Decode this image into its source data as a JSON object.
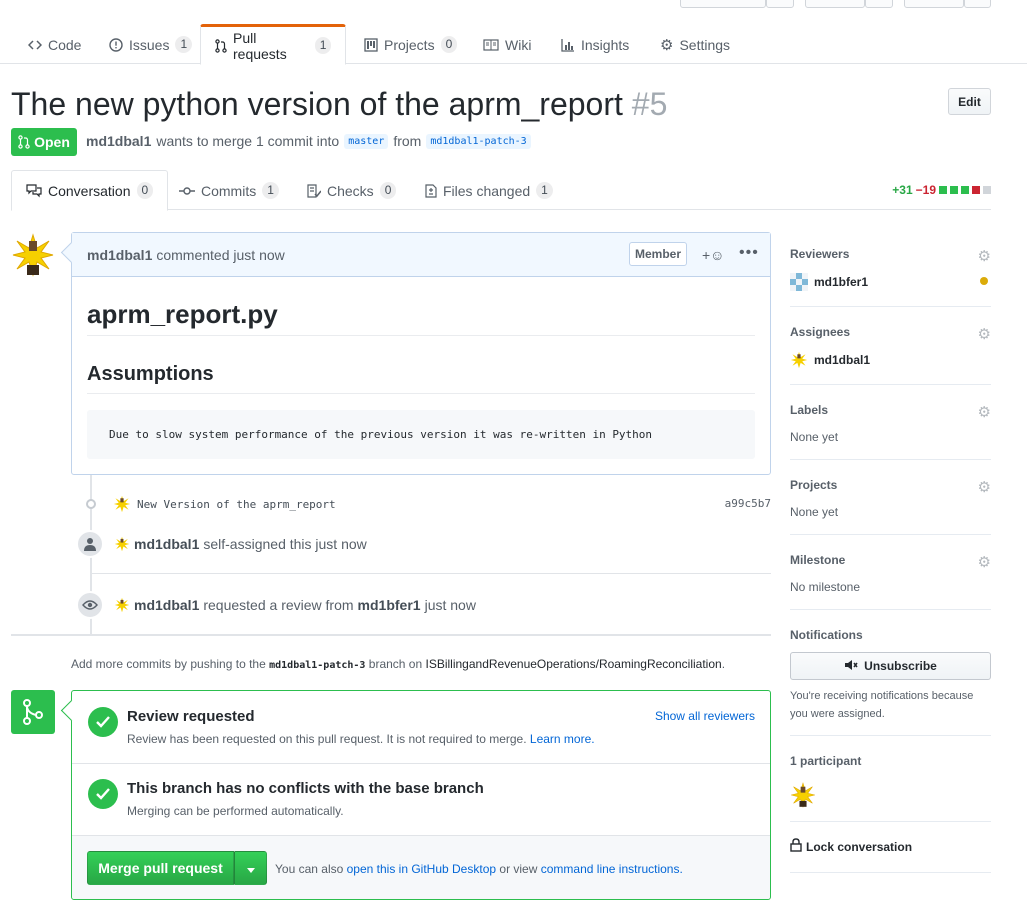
{
  "repo_tabs": [
    {
      "label": "Code",
      "count": null
    },
    {
      "label": "Issues",
      "count": "1"
    },
    {
      "label": "Pull requests",
      "count": "1"
    },
    {
      "label": "Projects",
      "count": "0"
    },
    {
      "label": "Wiki",
      "count": null
    },
    {
      "label": "Insights",
      "count": null
    },
    {
      "label": "Settings",
      "count": null
    }
  ],
  "pr": {
    "title": "The new python version of the aprm_report",
    "number": "#5",
    "edit_label": "Edit",
    "state": "Open",
    "author": "md1dbal1",
    "merge_text": "wants to merge 1 commit into",
    "base_branch": "master",
    "from_text": "from",
    "head_branch": "md1dbal1-patch-3"
  },
  "pr_tabs": [
    {
      "label": "Conversation",
      "count": "0"
    },
    {
      "label": "Commits",
      "count": "1"
    },
    {
      "label": "Checks",
      "count": "0"
    },
    {
      "label": "Files changed",
      "count": "1"
    }
  ],
  "diffstat": {
    "additions": "+31",
    "deletions": "−19"
  },
  "comment": {
    "author": "md1dbal1",
    "action": "commented just now",
    "role": "Member",
    "reaction": "+☺",
    "more": "•••",
    "heading1": "aprm_report.py",
    "heading2": "Assumptions",
    "code": "Due to slow system performance of the previous version it was re-written in Python"
  },
  "commit": {
    "message": "New Version of the aprm_report",
    "sha": "a99c5b7"
  },
  "events": [
    {
      "actor": "md1dbal1",
      "text": "self-assigned this just now"
    },
    {
      "actor": "md1dbal1",
      "text_a": "requested a review from",
      "target": "md1bfer1",
      "text_b": "just now"
    }
  ],
  "push_note": {
    "prefix": "Add more commits by pushing to the",
    "branch": "md1dbal1-patch-3",
    "middle": "branch on",
    "repo": "ISBillingandRevenueOperations/RoamingReconciliation",
    "suffix": "."
  },
  "merge": {
    "review_title": "Review requested",
    "review_sub": "Review has been requested on this pull request. It is not required to merge.",
    "learn_more": "Learn more.",
    "show_all": "Show all reviewers",
    "conflict_title": "This branch has no conflicts with the base branch",
    "conflict_sub": "Merging can be performed automatically.",
    "button": "Merge pull request",
    "note_a": "You can also",
    "note_link1": "open this in GitHub Desktop",
    "note_b": "or view",
    "note_link2": "command line instructions."
  },
  "sidebar": {
    "reviewers_heading": "Reviewers",
    "reviewer": "md1bfer1",
    "assignees_heading": "Assignees",
    "assignee": "md1dbal1",
    "labels_heading": "Labels",
    "labels_value": "None yet",
    "projects_heading": "Projects",
    "projects_value": "None yet",
    "milestone_heading": "Milestone",
    "milestone_value": "No milestone",
    "notifications_heading": "Notifications",
    "unsubscribe": "Unsubscribe",
    "notif_reason": "You're receiving notifications because you were assigned.",
    "participants": "1 participant",
    "lock": "Lock conversation"
  },
  "colors": {
    "open_green": "#2cbe4e",
    "link_blue": "#0366d6",
    "selected_tab_accent": "#e36209",
    "pending_yellow": "#dbab09"
  }
}
